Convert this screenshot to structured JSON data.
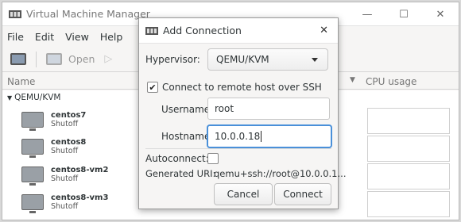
{
  "window": {
    "title": "Virtual Machine Manager",
    "controls": {
      "minimize": "—",
      "maximize": "☐",
      "close": "✕"
    }
  },
  "menubar": {
    "items": [
      "File",
      "Edit",
      "View",
      "Help"
    ]
  },
  "toolbar": {
    "open_label": "Open"
  },
  "columns": {
    "name": "Name",
    "cpu": "CPU usage"
  },
  "vm_list": {
    "group": "QEMU/KVM",
    "vms": [
      {
        "name": "centos7",
        "status": "Shutoff"
      },
      {
        "name": "centos8",
        "status": "Shutoff"
      },
      {
        "name": "centos8-vm2",
        "status": "Shutoff"
      },
      {
        "name": "centos8-vm3",
        "status": "Shutoff"
      }
    ]
  },
  "dialog": {
    "title": "Add Connection",
    "close": "✕",
    "hypervisor_label": "Hypervisor:",
    "hypervisor_value": "QEMU/KVM",
    "ssh_checkbox_label": "Connect to remote host over SSH",
    "ssh_checked": true,
    "check_mark": "✔",
    "username_label": "Username:",
    "username_value": "root",
    "hostname_label": "Hostname:",
    "hostname_value": "10.0.0.18",
    "autoconnect_label": "Autoconnect:",
    "autoconnect_checked": false,
    "uri_label": "Generated URI:",
    "uri_value": "qemu+ssh://root@10.0.0.1...",
    "cancel_label": "Cancel",
    "connect_label": "Connect"
  }
}
